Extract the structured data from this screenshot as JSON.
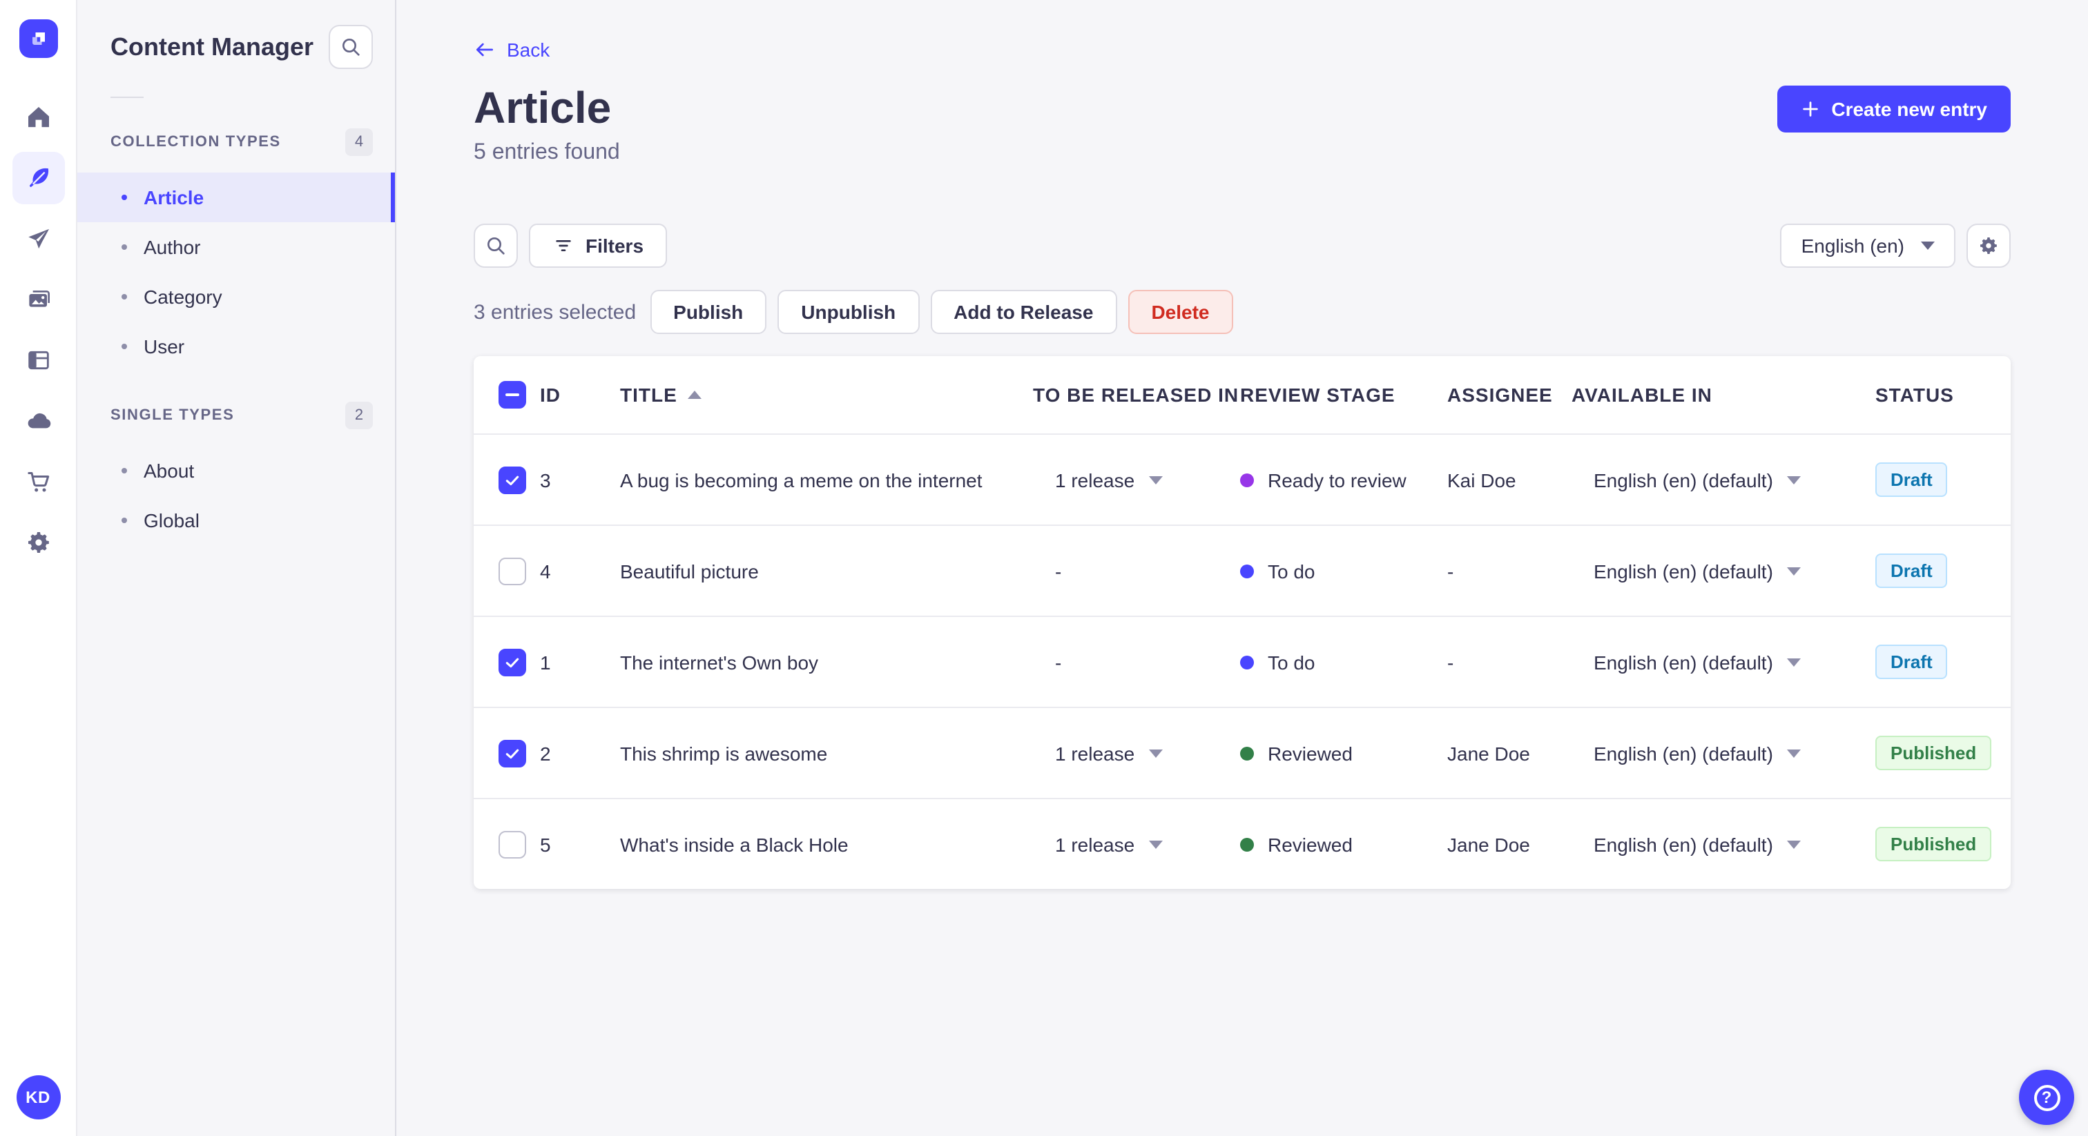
{
  "nav_rail": {
    "logo_icon": "strapi-logo-icon",
    "icons": [
      "home-icon",
      "content-manager-feather-icon",
      "releases-paper-plane-icon",
      "media-library-icon",
      "content-type-builder-icon",
      "cloud-icon",
      "marketplace-cart-icon",
      "settings-gear-icon"
    ],
    "active_icon": "content-manager-feather-icon",
    "avatar_initials": "KD"
  },
  "sidebar": {
    "title": "Content Manager",
    "sections": [
      {
        "label": "COLLECTION TYPES",
        "badge": "4",
        "items": [
          {
            "label": "Article",
            "active": true
          },
          {
            "label": "Author",
            "active": false
          },
          {
            "label": "Category",
            "active": false
          },
          {
            "label": "User",
            "active": false
          }
        ]
      },
      {
        "label": "SINGLE TYPES",
        "badge": "2",
        "items": [
          {
            "label": "About",
            "active": false
          },
          {
            "label": "Global",
            "active": false
          }
        ]
      }
    ]
  },
  "header": {
    "back_label": "Back",
    "title": "Article",
    "subtitle": "5 entries found",
    "create_button_label": "Create new entry"
  },
  "toolbar": {
    "filters_label": "Filters",
    "locale_selected": "English (en)"
  },
  "selection": {
    "summary": "3 entries selected",
    "publish_label": "Publish",
    "unpublish_label": "Unpublish",
    "add_to_release_label": "Add to Release",
    "delete_label": "Delete"
  },
  "table": {
    "headers": [
      "ID",
      "TITLE",
      "TO BE RELEASED IN",
      "REVIEW STAGE",
      "ASSIGNEE",
      "AVAILABLE IN",
      "STATUS"
    ],
    "sorted_by": "TITLE",
    "sort_direction": "asc",
    "select_all_state": "indeterminate",
    "rows": [
      {
        "checked": true,
        "id": "3",
        "title": "A bug is becoming a meme on the internet",
        "release": "1 release",
        "stage": "Ready to review",
        "stage_color": "#9736e8",
        "assignee": "Kai Doe",
        "locale": "English (en) (default)",
        "status": "Draft",
        "status_type": "draft"
      },
      {
        "checked": false,
        "id": "4",
        "title": "Beautiful picture",
        "release": "-",
        "stage": "To do",
        "stage_color": "#4945ff",
        "assignee": "-",
        "locale": "English (en) (default)",
        "status": "Draft",
        "status_type": "draft"
      },
      {
        "checked": true,
        "id": "1",
        "title": "The internet's Own boy",
        "release": "-",
        "stage": "To do",
        "stage_color": "#4945ff",
        "assignee": "-",
        "locale": "English (en) (default)",
        "status": "Draft",
        "status_type": "draft"
      },
      {
        "checked": true,
        "id": "2",
        "title": "This shrimp is awesome",
        "release": "1 release",
        "stage": "Reviewed",
        "stage_color": "#328048",
        "assignee": "Jane Doe",
        "locale": "English (en) (default)",
        "status": "Published",
        "status_type": "published"
      },
      {
        "checked": false,
        "id": "5",
        "title": "What's inside a Black Hole",
        "release": "1 release",
        "stage": "Reviewed",
        "stage_color": "#328048",
        "assignee": "Jane Doe",
        "locale": "English (en) (default)",
        "status": "Published",
        "status_type": "published"
      }
    ]
  },
  "colors": {
    "primary": "#4945ff",
    "danger_text": "#d02b20",
    "danger_bg": "#fcecea",
    "danger_border": "#f5c0b8",
    "draft_text": "#0c75af",
    "draft_bg": "#eaf5ff",
    "draft_border": "#b8e1ff",
    "published_text": "#328048",
    "published_bg": "#eafbe7",
    "published_border": "#c6f0c2",
    "stage_ready_to_review": "#9736e8",
    "stage_to_do": "#4945ff",
    "stage_reviewed": "#328048"
  },
  "help_button": {
    "icon": "question-mark-icon"
  }
}
